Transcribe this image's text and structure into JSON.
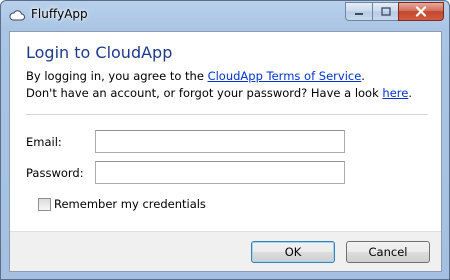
{
  "window": {
    "title": "FluffyApp",
    "icon": "cloud-icon",
    "controls": {
      "minimize": "minimize-icon",
      "maximize": "maximize-icon",
      "close": "close-icon"
    }
  },
  "dialog": {
    "heading": "Login to CloudApp",
    "intro_prefix": "By logging in, you agree to the ",
    "tos_link": "CloudApp Terms of Service",
    "intro_suffix": ".",
    "help_prefix": "Don't have an account, or forgot your password? Have a look ",
    "help_link": "here",
    "help_suffix": "."
  },
  "form": {
    "email_label": "Email:",
    "email_value": "",
    "password_label": "Password:",
    "password_value": "",
    "remember_label": "Remember my credentials",
    "remember_checked": false
  },
  "buttons": {
    "ok": "OK",
    "cancel": "Cancel"
  },
  "colors": {
    "heading": "#1e3a8a",
    "link": "#0033cc",
    "close_button": "#c2472f"
  }
}
